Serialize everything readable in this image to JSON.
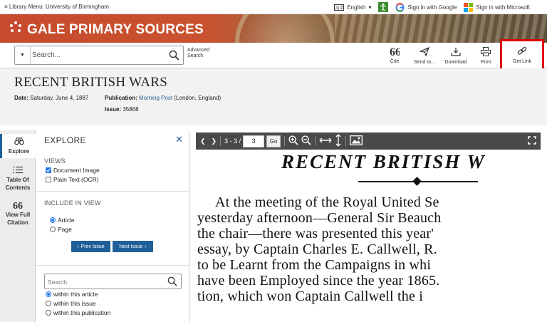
{
  "topbar": {
    "library_menu": "Library Menu: University of Birmingham",
    "language": "English",
    "google_signin": "Sign in with Google",
    "microsoft_signin": "Sign in with Microsoft"
  },
  "banner": {
    "brand": "GALE PRIMARY SOURCES"
  },
  "search": {
    "placeholder": "Search...",
    "advanced_line1": "Advanced",
    "advanced_line2": "Search"
  },
  "tools": {
    "cite": "Cite",
    "send": "Send to...",
    "download": "Download",
    "print": "Print",
    "get_link": "Get Link"
  },
  "article": {
    "title": "RECENT BRITISH WARS",
    "date_label": "Date:",
    "date_value": "Saturday, June 4, 1887",
    "publication_label": "Publication:",
    "publication_link": "Morning Post",
    "publication_place": "(London, England)",
    "issue_label": "Issue:",
    "issue_value": "35868"
  },
  "rail": {
    "explore": "Explore",
    "toc_line1": "Table Of",
    "toc_line2": "Contents",
    "citation_line1": "View Full",
    "citation_line2": "Citation"
  },
  "explore_panel": {
    "title": "EXPLORE",
    "views_label": "VIEWS",
    "view_document_image": "Document Image",
    "view_plain_text": "Plain Text (OCR)",
    "include_label": "INCLUDE IN VIEW",
    "include_article": "Article",
    "include_page": "Page",
    "prev_issue": "Prev Issue",
    "next_issue": "Next Issue",
    "search_placeholder": "Search",
    "scope_article": "within this article",
    "scope_issue": "within this issue",
    "scope_publication": "within this publication"
  },
  "viewer": {
    "page_range": "3 - 3 /",
    "page_value": "3",
    "go": "Go",
    "headline": "RECENT  BRITISH  W",
    "lines": [
      "At the meeting of the Royal United Se",
      "yesterday afternoon—General Sir Beauch",
      "the chair—there was presented this year'",
      "essay, by Captain Charles E. Callwell, R.",
      "to be Learnt from the Campaigns in whi",
      "have been Employed since the year 1865.",
      "tion, which won Captain Callwell the i"
    ]
  },
  "colors": {
    "accent": "#1f5f99",
    "highlight": "#e00000",
    "banner": "#c84a2d"
  }
}
